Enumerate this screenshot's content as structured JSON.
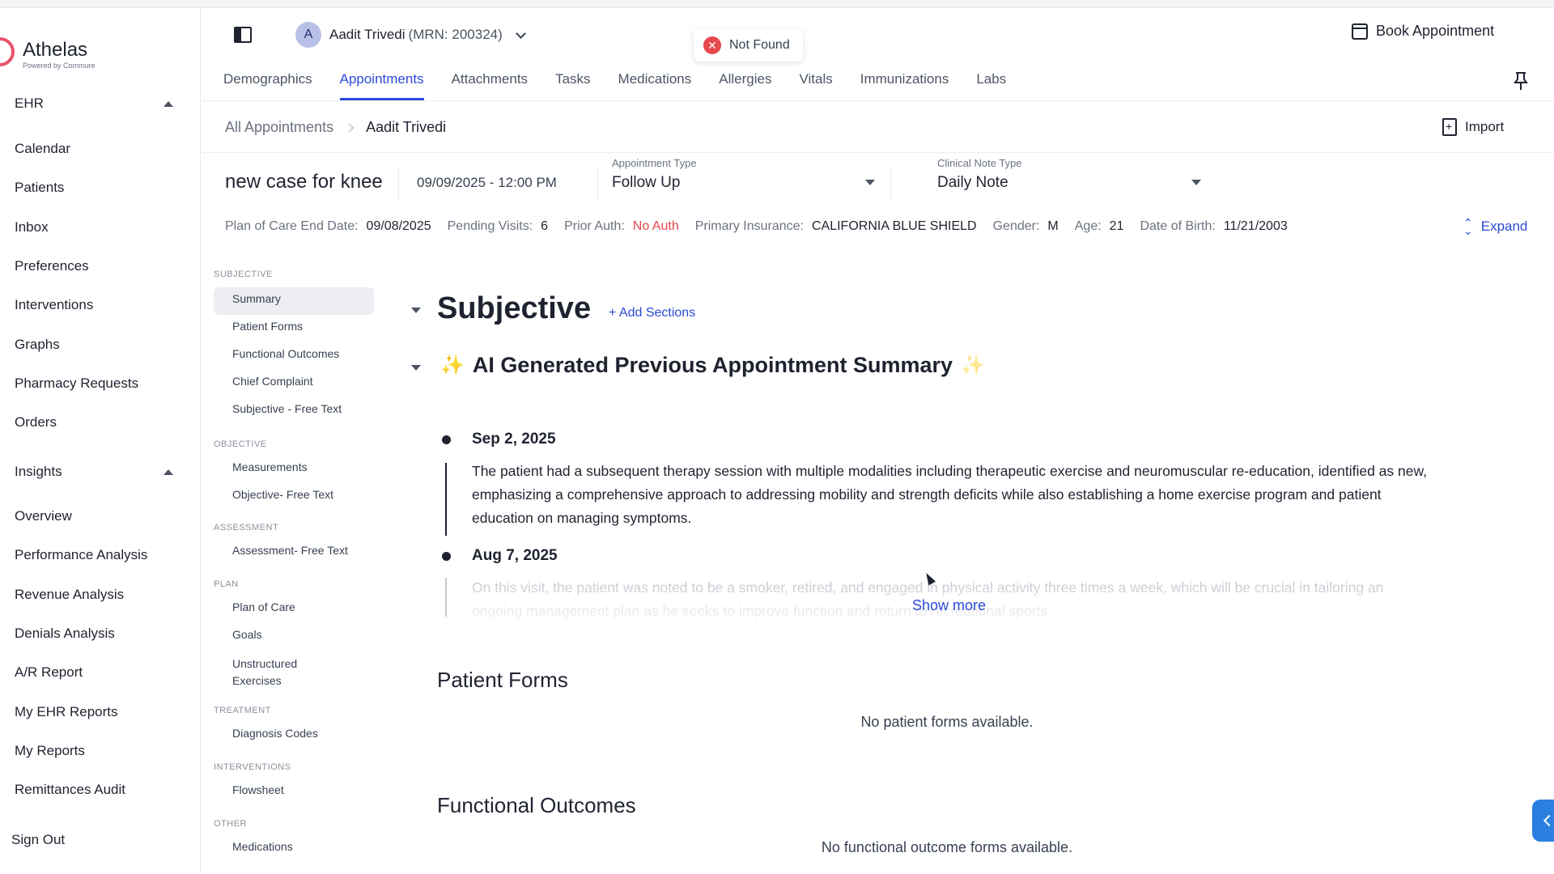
{
  "brand": {
    "name": "Athelas",
    "tagline": "Powered by Commure"
  },
  "leftnav": {
    "ehr_label": "EHR",
    "ehr_items": [
      "Calendar",
      "Patients",
      "Inbox",
      "Preferences",
      "Interventions",
      "Graphs",
      "Pharmacy Requests",
      "Orders"
    ],
    "insights_label": "Insights",
    "insights_items": [
      "Overview",
      "Performance Analysis",
      "Revenue Analysis",
      "Denials Analysis",
      "A/R Report",
      "My EHR Reports",
      "My Reports",
      "Remittances Audit"
    ],
    "sign_out": "Sign Out"
  },
  "header": {
    "avatar_initial": "A",
    "patient_name": "Aadit Trivedi",
    "patient_mrn": "(MRN: 200324)",
    "toast": "Not Found",
    "book_appointment": "Book Appointment",
    "tabs": [
      "Demographics",
      "Appointments",
      "Attachments",
      "Tasks",
      "Medications",
      "Allergies",
      "Vitals",
      "Immunizations",
      "Labs"
    ],
    "active_tab": "Appointments"
  },
  "breadcrumb": {
    "root": "All Appointments",
    "current": "Aadit Trivedi",
    "import": "Import"
  },
  "appointment": {
    "title": "new case for knee",
    "datetime": "09/09/2025 - 12:00 PM",
    "type_label": "Appointment Type",
    "type_value": "Follow Up",
    "note_label": "Clinical Note Type",
    "note_value": "Daily Note"
  },
  "info": {
    "poc_label": "Plan of Care End Date:",
    "poc_value": "09/08/2025",
    "pending_label": "Pending Visits:",
    "pending_value": "6",
    "auth_label": "Prior Auth:",
    "auth_value": "No Auth",
    "insurance_label": "Primary Insurance:",
    "insurance_value": "CALIFORNIA BLUE SHIELD",
    "gender_label": "Gender:",
    "gender_value": "M",
    "age_label": "Age:",
    "age_value": "21",
    "dob_label": "Date of Birth:",
    "dob_value": "11/21/2003",
    "expand": "Expand"
  },
  "section_nav": [
    {
      "group": "SUBJECTIVE",
      "items": [
        "Summary",
        "Patient Forms",
        "Functional Outcomes",
        "Chief Complaint",
        "Subjective - Free Text"
      ]
    },
    {
      "group": "OBJECTIVE",
      "items": [
        "Measurements",
        "Objective- Free Text"
      ]
    },
    {
      "group": "ASSESSMENT",
      "items": [
        "Assessment- Free Text"
      ]
    },
    {
      "group": "PLAN",
      "items": [
        "Plan of Care",
        "Goals",
        "Unstructured Exercises"
      ]
    },
    {
      "group": "TREATMENT",
      "items": [
        "Diagnosis Codes"
      ]
    },
    {
      "group": "INTERVENTIONS",
      "items": [
        "Flowsheet"
      ]
    },
    {
      "group": "OTHER",
      "items": [
        "Medications"
      ]
    }
  ],
  "main": {
    "subjective_heading": "Subjective",
    "add_sections": "+ Add Sections",
    "ai_heading": "AI Generated Previous Appointment Summary",
    "sparkle": "✨",
    "entries": [
      {
        "date": "Sep 2, 2025",
        "text": "The patient had a subsequent therapy session with multiple modalities including therapeutic exercise and neuromuscular re-education, identified as new, emphasizing a comprehensive approach to addressing mobility and strength deficits while also establishing a home exercise program and patient education on managing symptoms."
      },
      {
        "date": "Aug 7, 2025",
        "text": "On this visit, the patient was noted to be a smoker, retired, and engaged in physical activity three times a week, which will be crucial in tailoring an ongoing management plan as he seeks to improve function and return to recreational sports."
      }
    ],
    "show_more": "Show more",
    "patient_forms_heading": "Patient Forms",
    "patient_forms_empty": "No patient forms available.",
    "functional_heading": "Functional Outcomes",
    "functional_empty": "No functional outcome forms available."
  },
  "colors": {
    "accent": "#2b4bd6",
    "alert": "#e5484d",
    "brand": "#e8546a",
    "side_tab": "#2b7fe0"
  }
}
